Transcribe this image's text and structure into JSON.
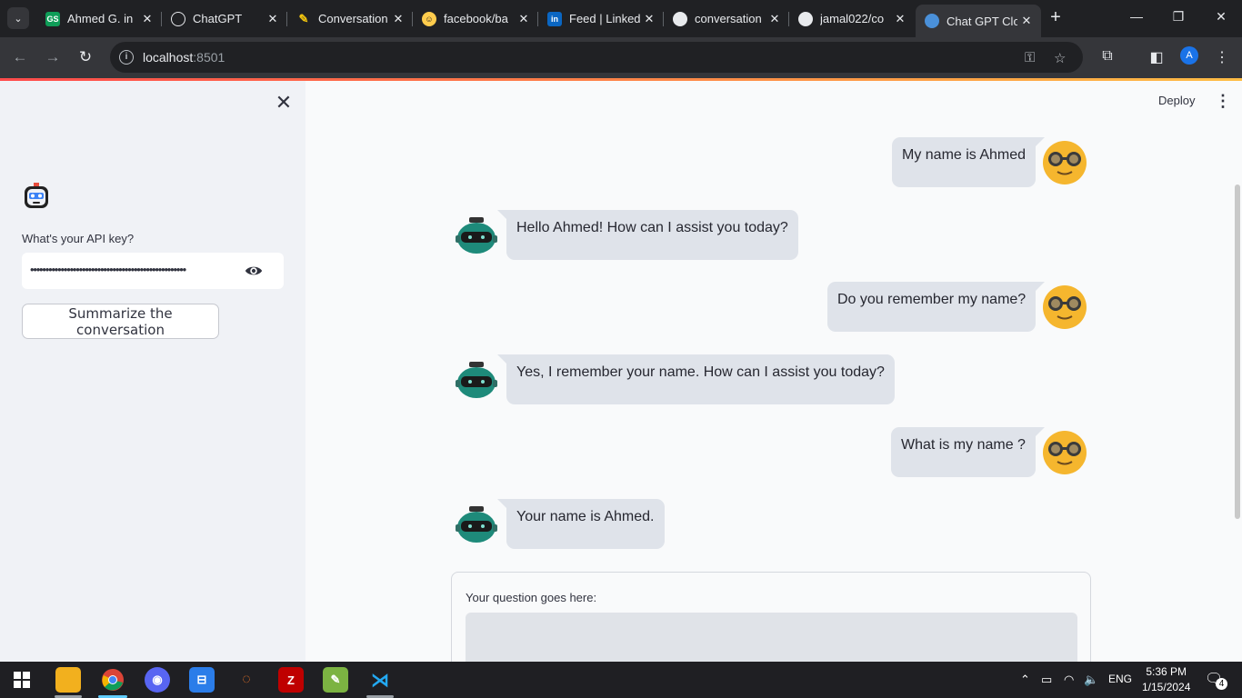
{
  "browser": {
    "tabs": [
      {
        "title": "Ahmed G. in",
        "favicon": "gs-icon",
        "color": "#0f9d58"
      },
      {
        "title": "ChatGPT",
        "favicon": "chatgpt-icon",
        "color": "#10a37f"
      },
      {
        "title": "Conversation",
        "favicon": "pen-icon",
        "color": "#f1c40f"
      },
      {
        "title": "facebook/ba",
        "favicon": "huggingface-icon",
        "color": "#ffcc4d"
      },
      {
        "title": "Feed | Linked",
        "favicon": "linkedin-icon",
        "color": "#0a66c2"
      },
      {
        "title": "conversation",
        "favicon": "github-icon",
        "color": "#ffffff"
      },
      {
        "title": "jamal022/co",
        "favicon": "github-icon",
        "color": "#ffffff"
      },
      {
        "title": "Chat GPT Clo",
        "favicon": "robot-icon",
        "color": "#4a90d9"
      }
    ],
    "active_tab": 7,
    "url_host": "localhost",
    "url_port": ":8501",
    "profile_initial": "A"
  },
  "sidebar": {
    "close_icon": "✕",
    "api_label": "What's your API key?",
    "api_value": "•••••••••••••••••••••••••••••••••••••••••••••••••••",
    "summarize_label": "Summarize the conversation"
  },
  "header": {
    "deploy_label": "Deploy",
    "menu_icon": "⋮"
  },
  "chat": {
    "messages": [
      {
        "role": "user",
        "text": "My name is Ahmed"
      },
      {
        "role": "bot",
        "text": "Hello Ahmed! How can I assist you today?"
      },
      {
        "role": "user",
        "text": "Do you remember my name?"
      },
      {
        "role": "bot",
        "text": "Yes, I remember your name. How can I assist you today?"
      },
      {
        "role": "user",
        "text": "What is my name ?"
      },
      {
        "role": "bot",
        "text": "Your name is Ahmed."
      }
    ],
    "input_label": "Your question goes here:"
  },
  "taskbar": {
    "apps": [
      "start-icon",
      "file-explorer-icon",
      "chrome-icon",
      "discord-icon",
      "app-icon",
      "jupyter-icon",
      "filezilla-icon",
      "notepad-icon",
      "vscode-icon"
    ],
    "language": "ENG",
    "time": "5:36 PM",
    "date": "1/15/2024",
    "notifications": "4"
  }
}
